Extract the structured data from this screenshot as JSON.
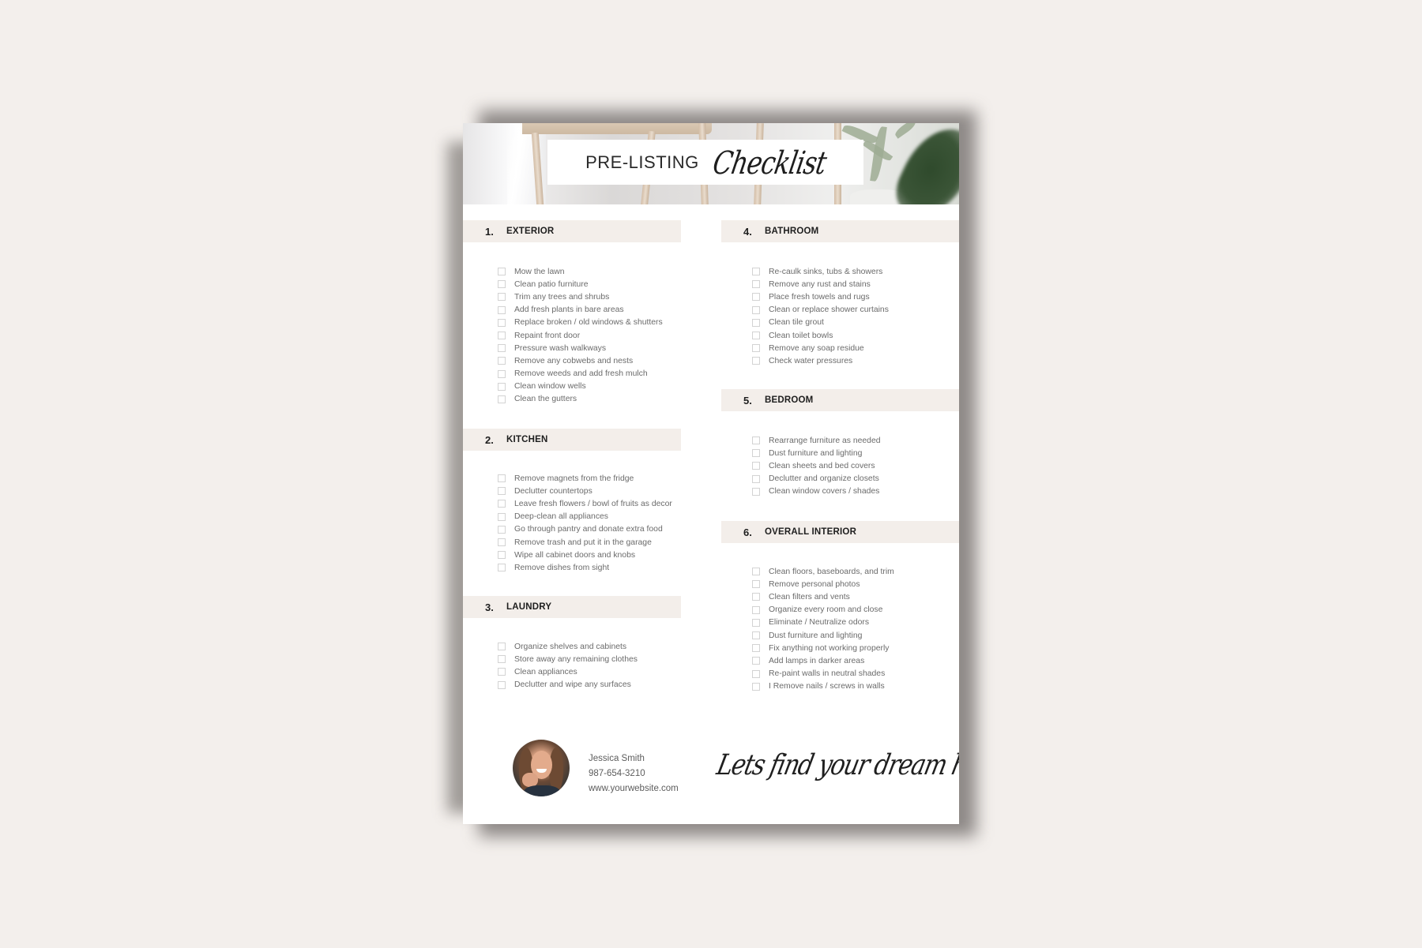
{
  "document": {
    "title_main": "PRE-LISTING",
    "title_script": "Checklist",
    "accent_band_color": "#f3eeea",
    "background_color": "#f3efec"
  },
  "sections": [
    {
      "number": "1.",
      "label": "EXTERIOR",
      "items": [
        "Mow the lawn",
        "Clean patio furniture",
        "Trim any trees and shrubs",
        "Add fresh plants in bare areas",
        "Replace broken / old windows & shutters",
        "Repaint front door",
        "Pressure wash walkways",
        "Remove any cobwebs and nests",
        "Remove weeds and add fresh mulch",
        "Clean window wells",
        "Clean the gutters"
      ]
    },
    {
      "number": "2.",
      "label": "KITCHEN",
      "items": [
        "Remove magnets from the fridge",
        "Declutter countertops",
        "Leave fresh flowers / bowl of fruits as decor",
        "Deep-clean all appliances",
        "Go through pantry and donate extra food",
        "Remove trash and put it in the garage",
        "Wipe all cabinet doors and knobs",
        "Remove dishes from sight"
      ]
    },
    {
      "number": "3.",
      "label": "LAUNDRY",
      "items": [
        "Organize shelves and cabinets",
        "Store away any remaining clothes",
        "Clean appliances",
        "Declutter and wipe any surfaces"
      ]
    },
    {
      "number": "4.",
      "label": "BATHROOM",
      "items": [
        "Re-caulk sinks, tubs & showers",
        "Remove any rust and stains",
        "Place fresh towels and rugs",
        "Clean or replace shower curtains",
        "Clean tile grout",
        "Clean toilet bowls",
        "Remove any soap residue",
        "Check water pressures"
      ]
    },
    {
      "number": "5.",
      "label": "BEDROOM",
      "items": [
        "Rearrange furniture as needed",
        "Dust furniture and lighting",
        "Clean sheets and bed covers",
        "Declutter and organize closets",
        "Clean window covers / shades"
      ]
    },
    {
      "number": "6.",
      "label": "OVERALL INTERIOR",
      "items": [
        "Clean floors, baseboards, and trim",
        "Remove personal photos",
        "Clean filters and vents",
        "Organize every room and close",
        "Eliminate / Neutralize odors",
        "Dust furniture and lighting",
        "Fix anything not working properly",
        "Add lamps in darker areas",
        "Re-paint walls in neutral shades",
        "I Remove nails / screws in walls"
      ]
    }
  ],
  "footer": {
    "name": "Jessica Smith",
    "phone": "987-654-3210",
    "website": "www.yourwebsite.com",
    "tagline": "Lets find your dream home"
  }
}
